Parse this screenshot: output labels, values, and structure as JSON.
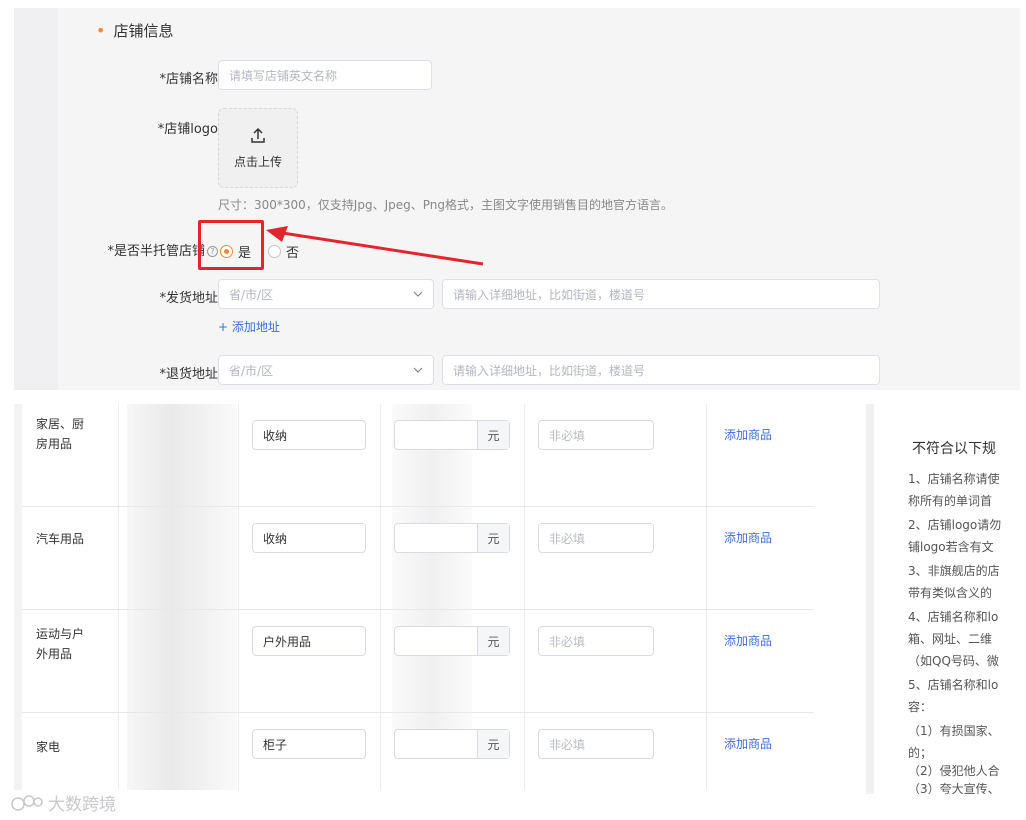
{
  "form": {
    "section_title": "店铺信息",
    "store_name": {
      "label": "*店铺名称",
      "placeholder": "请填写店铺英文名称"
    },
    "store_logo": {
      "label": "*店铺logo",
      "upload_text": "点击上传",
      "hint": "尺寸：300*300，仅支持Jpg、Jpeg、Png格式，主图文字使用销售目的地官方语言。"
    },
    "semi_managed": {
      "label": "*是否半托管店铺",
      "help": "?",
      "yes": "是",
      "no": "否",
      "selected": "是"
    },
    "ship_address": {
      "label": "*发货地址",
      "region_placeholder": "省/市/区",
      "detail_placeholder": "请输入详细地址，比如街道，楼道号",
      "add_link": "+ 添加地址"
    },
    "return_address": {
      "label": "*退货地址",
      "region_placeholder": "省/市/区",
      "detail_placeholder": "请输入详细地址，比如街道，楼道号"
    }
  },
  "table": {
    "unit": "元",
    "optional_placeholder": "非必填",
    "add_product": "添加商品",
    "rows": [
      {
        "category_line1": "家居、厨",
        "category_line2": "房用品",
        "value": "收纳"
      },
      {
        "category_line1": "汽车用品",
        "category_line2": "",
        "value": "收纳"
      },
      {
        "category_line1": "运动与户",
        "category_line2": "外用品",
        "value": "户外用品"
      },
      {
        "category_line1": "家电",
        "category_line2": "",
        "value": "柜子"
      }
    ]
  },
  "rules": {
    "title": "不符合以下规",
    "lines": [
      "1、店铺名称请使",
      "称所有的单词首",
      "2、店铺logo请勿",
      "铺logo若含有文",
      "3、非旗舰店的店",
      "带有类似含义的",
      "4、店铺名称和lo",
      "箱、网址、二维",
      "（如QQ号码、微",
      "5、店铺名称和lo",
      "容：",
      "（1）有损国家、",
      "的；",
      "（2）侵犯他人合",
      "（3）夸大宣传、"
    ]
  },
  "watermark": "大数跨境",
  "colors": {
    "accent": "#f08a36",
    "highlight": "#e3262d",
    "link": "#3c6fd6"
  }
}
